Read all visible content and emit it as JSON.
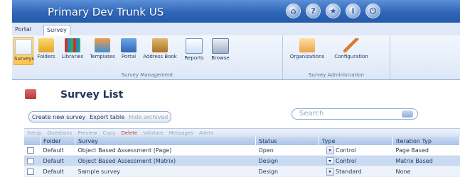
{
  "window": {
    "title": "Primary Dev Trunk US"
  },
  "title_icons": [
    "home-icon",
    "help-icon",
    "star-icon",
    "info-icon",
    "power-icon"
  ],
  "title_icon_glyphs": [
    "⌂",
    "?",
    "★",
    "i",
    "⏻"
  ],
  "tabs": [
    {
      "label": "Portal"
    },
    {
      "label": "Survey"
    }
  ],
  "ribbon": {
    "groups": [
      {
        "label": "Survey Management",
        "buttons": [
          "Surveys",
          "Folders",
          "Libraries",
          "Templates",
          "Portal",
          "Address Book",
          "Reports",
          "Browse"
        ]
      },
      {
        "label": "Survey Administration",
        "buttons": [
          "Organizations",
          "Configuration"
        ]
      }
    ]
  },
  "main": {
    "title": "Survey List",
    "actions": [
      "Create new survey",
      "Export table",
      "Hide archived"
    ],
    "search": {
      "placeholder": "Search"
    },
    "toolbar": [
      "Setup",
      "Questions",
      "Preview",
      "Copy",
      "Delete",
      "Validate",
      "Messages",
      "Alerts"
    ]
  },
  "table": {
    "headers": [
      "",
      "Folder",
      "Survey",
      "Status",
      "Type",
      "Iteration Typ"
    ],
    "rows": [
      [
        "",
        "Default",
        "Object Based Assessment (Page)",
        "Open",
        "Control",
        "Page Based"
      ],
      [
        "",
        "Default",
        "Object Based Assessment (Matrix)",
        "Design",
        "Control",
        "Matrix Based"
      ],
      [
        "",
        "Default",
        "Sample survey",
        "Design",
        "Standard",
        "None"
      ]
    ]
  },
  "colors": {
    "title_bar": "#2f66b8",
    "selected_button": "#ffc44a",
    "delete": "#c43a3a"
  }
}
